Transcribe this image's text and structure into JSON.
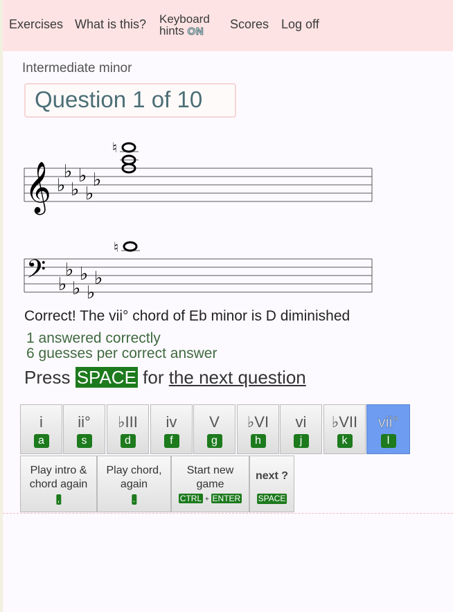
{
  "nav": {
    "exercises": "Exercises",
    "what_is_this": "What is this?",
    "keyboard_hints_line1": "Keyboard",
    "keyboard_hints_line2": "hints",
    "keyboard_hints_state": "ON",
    "scores": "Scores",
    "log_off": "Log off"
  },
  "level_title": "Intermediate minor",
  "question_label": "Question 1 of 10",
  "feedback": "Correct! The vii° chord of Eb minor is D diminished",
  "stats": {
    "answered": "1 answered correctly",
    "guesses": "6 guesses per correct answer"
  },
  "prompt": {
    "press": "Press",
    "key": "SPACE",
    "for": "for",
    "link": "the next question"
  },
  "answer_buttons": [
    {
      "label": "i",
      "key": "a",
      "selected": false
    },
    {
      "label": "ii°",
      "key": "s",
      "selected": false
    },
    {
      "label": "♭III",
      "key": "d",
      "selected": false
    },
    {
      "label": "iv",
      "key": "f",
      "selected": false
    },
    {
      "label": "V",
      "key": "g",
      "selected": false
    },
    {
      "label": "♭VI",
      "key": "h",
      "selected": false
    },
    {
      "label": "vi",
      "key": "j",
      "selected": false
    },
    {
      "label": "♭VII",
      "key": "k",
      "selected": false
    },
    {
      "label": "vii°",
      "key": "l",
      "selected": true
    }
  ],
  "action_buttons": {
    "play_intro": {
      "line1": "Play intro &",
      "line2": "chord again",
      "key": ","
    },
    "play_chord": {
      "line1": "Play chord,",
      "line2": "again",
      "key": "."
    },
    "start_new": {
      "line1": "Start new",
      "line2": "game",
      "key1": "CTRL",
      "plus": "+",
      "key2": "ENTER"
    },
    "next": {
      "label": "next ?",
      "key": "SPACE"
    }
  },
  "notation": {
    "key_signature": "Eb minor (6 flats)",
    "treble_notes": [
      "D5",
      "F5",
      "A♮5"
    ],
    "bass_note": "B♮3"
  },
  "colors": {
    "nav_bg": "#fde3e3",
    "key_badge": "#1d7a1d",
    "selected_button": "#6d9cf0",
    "stat_text": "#3f6a3f"
  }
}
